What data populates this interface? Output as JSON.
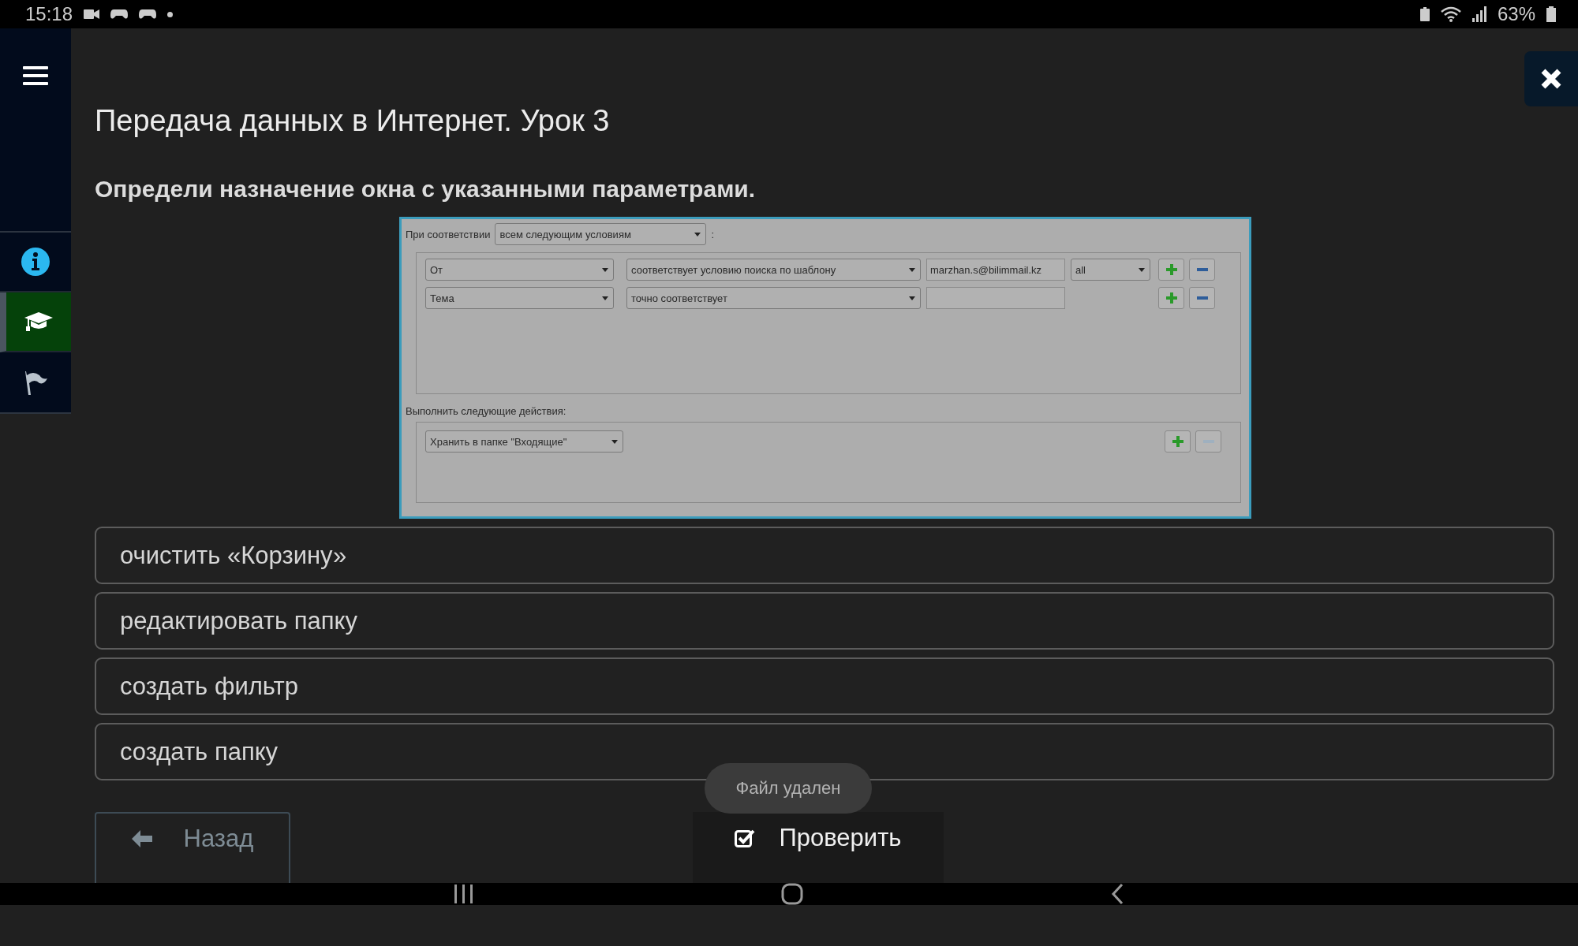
{
  "status_bar": {
    "time": "15:18",
    "battery": "63%"
  },
  "sidebar": {
    "items": [
      {
        "kind": "info",
        "selected": false
      },
      {
        "kind": "course",
        "selected": true
      },
      {
        "kind": "flag",
        "selected": false
      }
    ]
  },
  "lesson_title": "Передача данных в Интернет. Урок 3",
  "question": "Определи назначение окна с указанными параметрами.",
  "figure": {
    "match_label": "При соответствии",
    "match_value": "всем следующим условиям",
    "match_suffix": ":",
    "conditions": [
      {
        "field": "От",
        "operator": "соответствует условию поиска по шаблону",
        "value": "marzhan.s@bilimmail.kz",
        "option": "all",
        "remove_disabled": false
      },
      {
        "field": "Тема",
        "operator": "точно соответствует",
        "remove_disabled": false
      }
    ],
    "actions_label": "Выполнить следующие действия:",
    "actions": [
      {
        "value": "Хранить в папке \"Входящие\"",
        "remove_disabled": true
      }
    ]
  },
  "options": [
    {
      "text": "очистить «Корзину»",
      "selected": false
    },
    {
      "text": "редактировать папку",
      "selected": false
    },
    {
      "text": "создать фильтр",
      "selected": false
    },
    {
      "text": "создать папку",
      "selected": false
    }
  ],
  "toast": "Файл удален",
  "buttons": {
    "back": "Назад",
    "check": "Проверить"
  }
}
